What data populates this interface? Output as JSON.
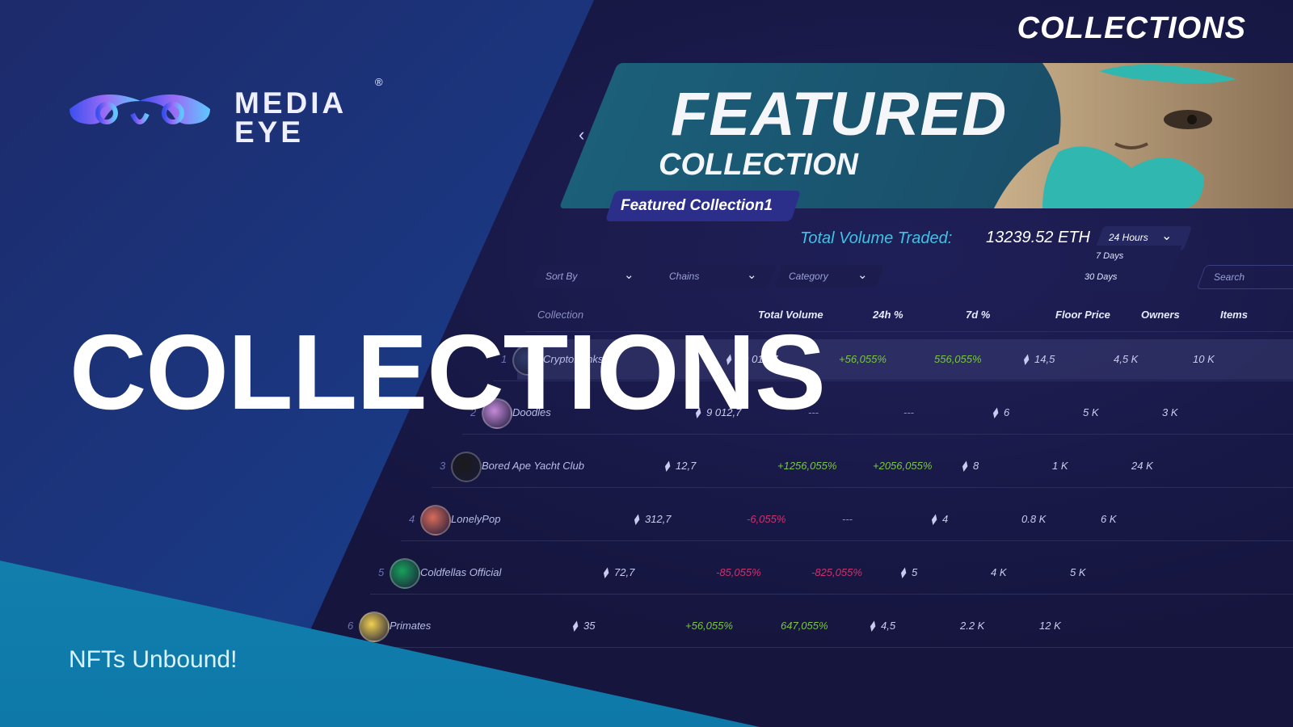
{
  "brand": {
    "name_line1": "MEDIA",
    "name_line2": "EYE",
    "registered": "®"
  },
  "hero": {
    "title": "COLLECTIONS",
    "tagline": "NFTs Unbound!"
  },
  "page": {
    "title": "COLLECTIONS"
  },
  "banner": {
    "heading": "FEATURED",
    "subheading": "COLLECTION",
    "pill_label": "Featured Collection1",
    "prev_icon": "chevron-left-icon"
  },
  "volume": {
    "label": "Total Volume Traded:",
    "value": "13239.52 ETH",
    "period_selected": "24 Hours",
    "period_options": [
      "7 Days",
      "30 Days"
    ]
  },
  "filters": {
    "sort_by": "Sort By",
    "chains": "Chains",
    "category": "Category",
    "search_placeholder": "Search"
  },
  "table": {
    "headers": {
      "collection": "Collection",
      "total_volume": "Total Volume",
      "change_24h": "24h %",
      "change_7d": "7d %",
      "floor_price": "Floor Price",
      "owners": "Owners",
      "items": "Items"
    },
    "rows": [
      {
        "rank": "1",
        "name": "CryptoPunks",
        "volume": "19 012,7",
        "change_24h": "+56,055%",
        "change_7d": "556,055%",
        "floor": "14,5",
        "owners": "4,5 K",
        "items": "10 K",
        "c24": "pos",
        "c7": "pos"
      },
      {
        "rank": "2",
        "name": "Doodles",
        "volume": "9 012,7",
        "change_24h": "---",
        "change_7d": "---",
        "floor": "6",
        "owners": "5 K",
        "items": "3 K",
        "c24": "dash",
        "c7": "dash"
      },
      {
        "rank": "3",
        "name": "Bored Ape Yacht Club",
        "volume": "12,7",
        "change_24h": "+1256,055%",
        "change_7d": "+2056,055%",
        "floor": "8",
        "owners": "1 K",
        "items": "24 K",
        "c24": "pos",
        "c7": "pos"
      },
      {
        "rank": "4",
        "name": "LonelyPop",
        "volume": "312,7",
        "change_24h": "-6,055%",
        "change_7d": "---",
        "floor": "4",
        "owners": "0.8 K",
        "items": "6 K",
        "c24": "neg",
        "c7": "dash"
      },
      {
        "rank": "5",
        "name": "Coldfellas Official",
        "volume": "72,7",
        "change_24h": "-85,055%",
        "change_7d": "-825,055%",
        "floor": "5",
        "owners": "4 K",
        "items": "5 K",
        "c24": "neg",
        "c7": "neg"
      },
      {
        "rank": "6",
        "name": "Primates",
        "volume": "35",
        "change_24h": "+56,055%",
        "change_7d": "647,055%",
        "floor": "4,5",
        "owners": "2.2 K",
        "items": "12 K",
        "c24": "pos",
        "c7": "pos"
      }
    ]
  },
  "colors": {
    "accent_cyan": "#3ec3e6",
    "positive": "#7ac83a",
    "negative": "#d1306b",
    "teal": "#1b8fb8"
  }
}
